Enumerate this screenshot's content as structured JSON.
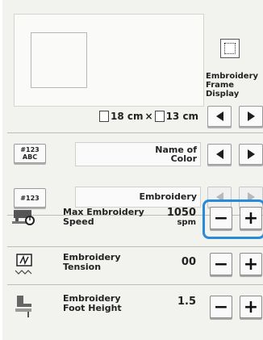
{
  "frame": {
    "display_label": "Embroidery Frame Display",
    "height": "18 cm",
    "times": "×",
    "width": "13 cm"
  },
  "color_row": {
    "icon_top": "#123",
    "icon_bottom": "ABC",
    "value": "Name of\nColor"
  },
  "thread_row": {
    "icon": "#123",
    "value": "Embroidery"
  },
  "speed": {
    "label": "Max Embroidery\nSpeed",
    "value": "1050",
    "unit": "spm"
  },
  "tension": {
    "label": "Embroidery\nTension",
    "value": "00"
  },
  "foot_height": {
    "label": "Embroidery\nFoot Height",
    "value": "1.5"
  },
  "controls": {
    "minus": "−",
    "plus": "+"
  },
  "colors": {
    "highlight": "#2b8ad8",
    "panel_bg": "#f2f2ef"
  }
}
